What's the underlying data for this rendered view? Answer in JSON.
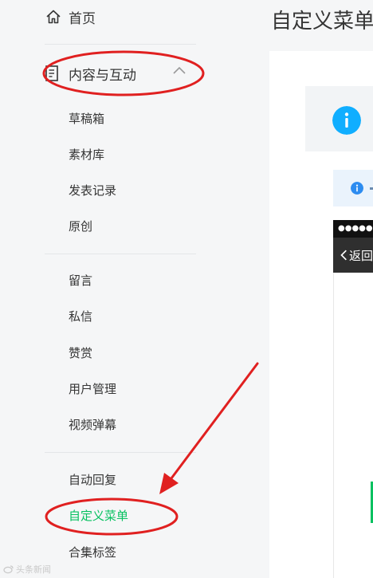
{
  "sidebar": {
    "home_label": "首页",
    "section_label": "内容与互动",
    "items": [
      {
        "label": "草稿箱"
      },
      {
        "label": "素材库"
      },
      {
        "label": "发表记录"
      },
      {
        "label": "原创"
      },
      {
        "label": "留言"
      },
      {
        "label": "私信"
      },
      {
        "label": "赞赏"
      },
      {
        "label": "用户管理"
      },
      {
        "label": "视频弹幕"
      },
      {
        "label": "自动回复"
      },
      {
        "label": "自定义菜单",
        "active": true
      },
      {
        "label": "合集标签"
      }
    ]
  },
  "main": {
    "page_title": "自定义菜单",
    "phone": {
      "status_text": "●●●●● W",
      "back_label": "返回"
    }
  },
  "watermark": "头条新闻",
  "colors": {
    "active_green": "#07c160",
    "info_blue": "#10aeff",
    "annotation_red": "#e02020"
  }
}
